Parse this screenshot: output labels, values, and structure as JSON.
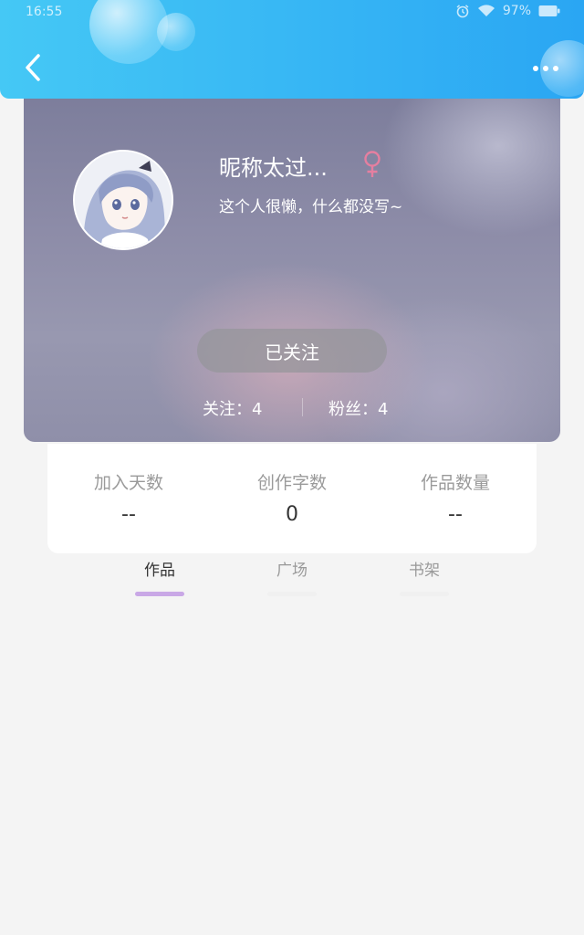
{
  "status_bar": {
    "time": "16:55",
    "battery": "97%"
  },
  "header": {
    "back_icon": "chevron-left-icon",
    "more_icon": "more-dots-icon",
    "color_start": "#45c8f5",
    "color_end": "#2aa6f3"
  },
  "profile": {
    "nickname": "昵称太过...",
    "gender_icon": "female-icon",
    "gender_color": "#e57fa0",
    "bio": "这个人很懒，什么都没写~",
    "follow_button": "已关注",
    "following": "关注：4",
    "fans": "粉丝：4"
  },
  "info": {
    "join_days_label": "加入天数",
    "join_days_value": "--",
    "word_count_label": "创作字数",
    "word_count_value": "0",
    "works_count_label": "作品数量",
    "works_count_value": "--"
  },
  "tabs": [
    {
      "label": "作品",
      "active": true
    },
    {
      "label": "广场",
      "active": false
    },
    {
      "label": "书架",
      "active": false
    }
  ],
  "colors": {
    "active_tab_indicator": "#c9a8e6",
    "page_background": "#f4f4f4"
  }
}
